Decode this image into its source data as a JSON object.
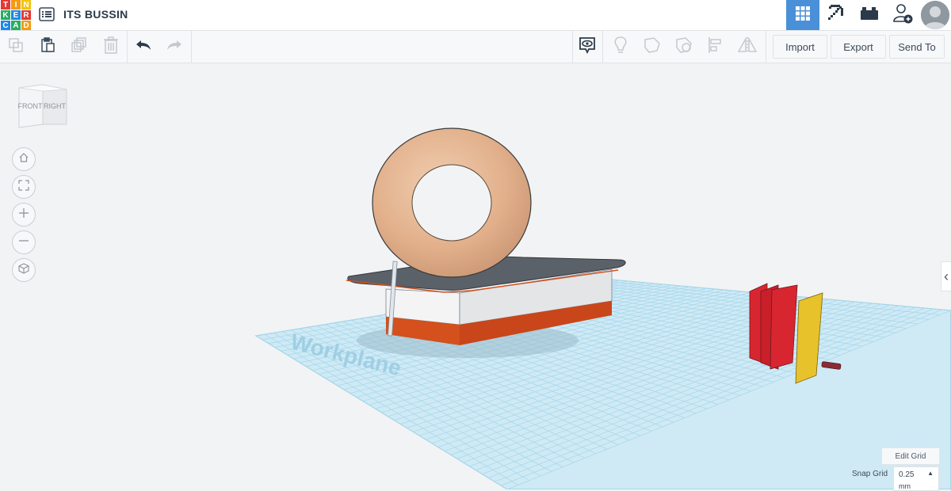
{
  "app": {
    "logo_letters": [
      "T",
      "I",
      "N",
      "K",
      "E",
      "R",
      "C",
      "A",
      "D"
    ],
    "logo_colors": [
      "#e53935",
      "#f39c12",
      "#f1c40f",
      "#27ae60",
      "#1e88e5",
      "#e53935",
      "#1e88e5",
      "#27ae60",
      "#f39c12"
    ],
    "design_title": "ITS BUSSIN"
  },
  "topbar": {
    "icons": [
      "list-icon",
      "grid-view-icon",
      "pickaxe-icon",
      "brick-icon",
      "add-user-icon",
      "avatar"
    ],
    "active_color": "#4a90d9"
  },
  "toolbar": {
    "left_tools": [
      "copy-icon",
      "paste-icon",
      "duplicate-icon",
      "delete-icon",
      "undo-icon",
      "redo-icon"
    ],
    "right_tools": [
      "notes-icon",
      "light-bulb-icon",
      "solid-shape-icon",
      "hole-shape-icon",
      "align-icon",
      "mirror-icon"
    ],
    "import_label": "Import",
    "export_label": "Export",
    "send_to_label": "Send To"
  },
  "viewcube": {
    "front_label": "FRONT",
    "right_label": "RIGHT"
  },
  "nav_controls": [
    "home-icon",
    "fit-all-icon",
    "zoom-in-icon",
    "zoom-out-icon",
    "perspective-icon"
  ],
  "workplane": {
    "grid_color": "#9fd4ea",
    "watermark": "Workplane"
  },
  "scene_objects": {
    "donut_color": "#e7b895",
    "stand_top_color": "#5b6168",
    "stand_body_color": "#e4e5e7",
    "stand_base_color": "#d4501c",
    "panel_red_color": "#d82630",
    "panel_yellow_color": "#e8c22b"
  },
  "grid_controls": {
    "edit_grid_label": "Edit Grid",
    "snap_grid_label": "Snap Grid",
    "snap_value": "0.25",
    "snap_unit": "mm"
  }
}
